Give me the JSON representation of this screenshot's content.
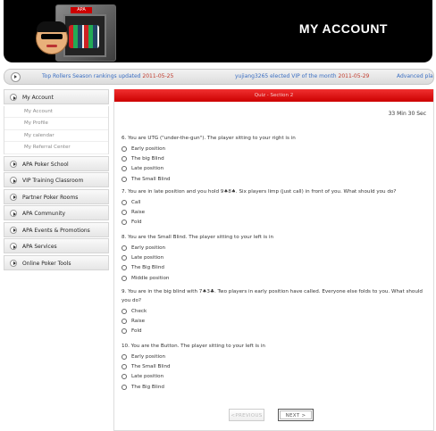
{
  "header": {
    "title": "MY ACCOUNT",
    "safe_tag": "APA"
  },
  "ticker": {
    "item1_text": "Top Rollers Season rankings updated ",
    "item1_date": "2011-05-25",
    "item2_text": "yujiang3265 elected VIP of the month ",
    "item2_date": "2011-05-29",
    "item3_text": "Advanced pla"
  },
  "sidebar": {
    "my_account": "My Account",
    "sub_items": [
      "My Account",
      "My Profile",
      "My calendar",
      "My Referral Center"
    ],
    "items": [
      "APA Poker School",
      "VIP Training Classroom",
      "Partner Poker Rooms",
      "APA Community",
      "APA Events & Promotions",
      "APA Services",
      "Online Poker Tools"
    ]
  },
  "quiz": {
    "section_title": "Quiz - Section 2",
    "timer": "33 Min 30 Sec",
    "questions": [
      {
        "text": "6. You are UTG (\"under-the-gun\"). The player sitting to your right is in",
        "options": [
          "Early position",
          "The big Blind",
          "Late position",
          "The Small Blind"
        ]
      },
      {
        "text": "7. You are in late position and you hold 9♠8♠. Six players limp (just call) in front of you. What should you do?",
        "options": [
          "Call",
          "Raise",
          "Fold"
        ]
      },
      {
        "text": "8. You are the Small Blind. The player sitting to your left is in",
        "options": [
          "Early position",
          "Late position",
          "The Big Blind",
          "Middle position"
        ]
      },
      {
        "text": "9. You are in the big blind with 7♠3♣. Two players in early position have called. Everyone else folds to you. What should you do?",
        "options": [
          "Check",
          "Raise",
          "Fold"
        ]
      },
      {
        "text": "10. You are the Button. The player sitting to your left is in",
        "options": [
          "Early position",
          "The Small Blind",
          "Late position",
          "The Big Blind"
        ]
      }
    ],
    "prev_label": "<PREVIOUS",
    "next_label": "NEXT >"
  }
}
